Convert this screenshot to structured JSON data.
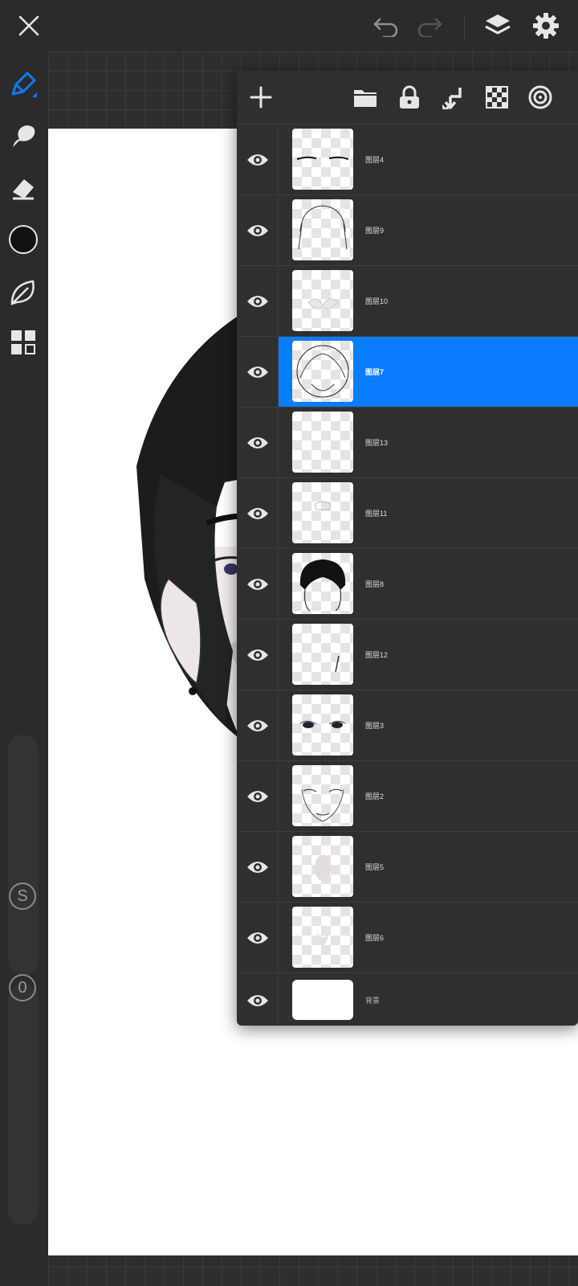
{
  "app": {
    "colors": {
      "accent": "#0a7cff",
      "toolbar_bg": "#2b2b2b",
      "panel_bg": "#2f2f2f",
      "icon": "#e6e6e6"
    }
  },
  "topbar": {
    "icons": [
      "close-icon",
      "undo-icon",
      "redo-icon",
      "layers-icon",
      "settings-icon"
    ]
  },
  "left_toolbar": {
    "tools": [
      "brush-icon",
      "smudge-icon",
      "eraser-icon",
      "color-icon",
      "adjust-icon",
      "gallery-icon"
    ],
    "size_label": "S",
    "opacity_label": "0"
  },
  "layers_panel": {
    "toolbar_icons": [
      "add-layer-icon",
      "folder-icon",
      "lock-icon",
      "merge-down-icon",
      "checker-icon",
      "target-icon"
    ],
    "layers": [
      {
        "name": "图层4",
        "visible": true,
        "selected": false
      },
      {
        "name": "图层9",
        "visible": true,
        "selected": false
      },
      {
        "name": "图层10",
        "visible": true,
        "selected": false
      },
      {
        "name": "图层7",
        "visible": true,
        "selected": true
      },
      {
        "name": "图层13",
        "visible": true,
        "selected": false
      },
      {
        "name": "图层11",
        "visible": true,
        "selected": false
      },
      {
        "name": "图层8",
        "visible": true,
        "selected": false
      },
      {
        "name": "图层12",
        "visible": true,
        "selected": false
      },
      {
        "name": "图层3",
        "visible": true,
        "selected": false
      },
      {
        "name": "图层2",
        "visible": true,
        "selected": false
      },
      {
        "name": "图层5",
        "visible": true,
        "selected": false
      },
      {
        "name": "图层6",
        "visible": true,
        "selected": false
      },
      {
        "name": "背景",
        "visible": true,
        "selected": false
      }
    ]
  }
}
